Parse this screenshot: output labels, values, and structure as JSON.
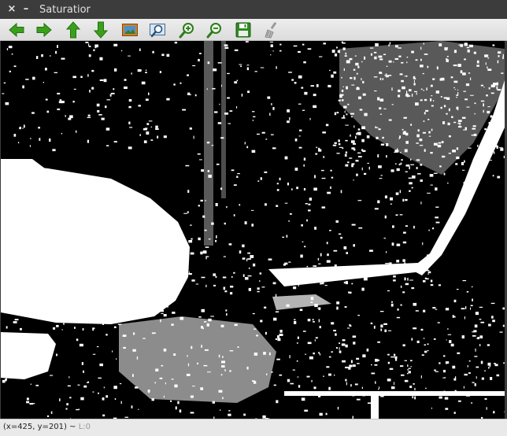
{
  "window": {
    "title": "Saturatior",
    "close_glyph": "×",
    "minimize_glyph": "–"
  },
  "toolbar": {
    "items": [
      {
        "name": "arrow-left-icon",
        "tooltip": "Pan left",
        "color": "#3aa01c"
      },
      {
        "name": "arrow-right-icon",
        "tooltip": "Pan right",
        "color": "#3aa01c"
      },
      {
        "name": "arrow-up-icon",
        "tooltip": "Pan up",
        "color": "#3aa01c"
      },
      {
        "name": "arrow-down-icon",
        "tooltip": "Pan down",
        "color": "#3aa01c"
      },
      {
        "name": "image-icon",
        "tooltip": "Zoom to fit"
      },
      {
        "name": "zoom-region-icon",
        "tooltip": "Zoom region"
      },
      {
        "name": "zoom-in-icon",
        "tooltip": "Zoom in"
      },
      {
        "name": "zoom-out-icon",
        "tooltip": "Zoom out"
      },
      {
        "name": "save-icon",
        "tooltip": "Save"
      },
      {
        "name": "brush-icon",
        "tooltip": "Properties"
      }
    ]
  },
  "image": {
    "description": "binary saturation threshold image",
    "colors": {
      "foreground": "#ffffff",
      "background": "#000000"
    }
  },
  "status": {
    "coords": "(x=425, y=201)",
    "separator": "~",
    "level": "L:0"
  }
}
